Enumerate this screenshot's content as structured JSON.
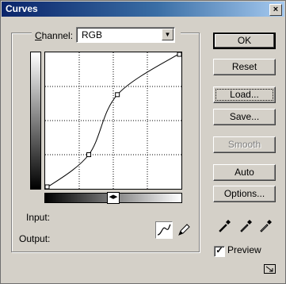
{
  "window": {
    "title": "Curves",
    "close_glyph": "×"
  },
  "channel": {
    "label_prefix": "C",
    "label_rest": "hannel:",
    "value": "RGB"
  },
  "buttons": {
    "ok": "OK",
    "reset": "Reset",
    "load": "Load...",
    "save": "Save...",
    "smooth": "Smooth",
    "auto": "Auto",
    "options": "Options..."
  },
  "io": {
    "input_label": "Input:",
    "output_label": "Output:"
  },
  "preview": {
    "label": "Preview",
    "checked": true
  },
  "curve": {
    "points": [
      [
        0,
        0
      ],
      [
        0.32,
        0.25
      ],
      [
        0.53,
        0.69
      ],
      [
        1,
        1
      ]
    ]
  },
  "icons": {
    "curve_tool": "curve-icon",
    "pencil_tool": "pencil-icon",
    "eyedroppers": [
      "black-eyedropper-icon",
      "gray-eyedropper-icon",
      "white-eyedropper-icon"
    ]
  }
}
